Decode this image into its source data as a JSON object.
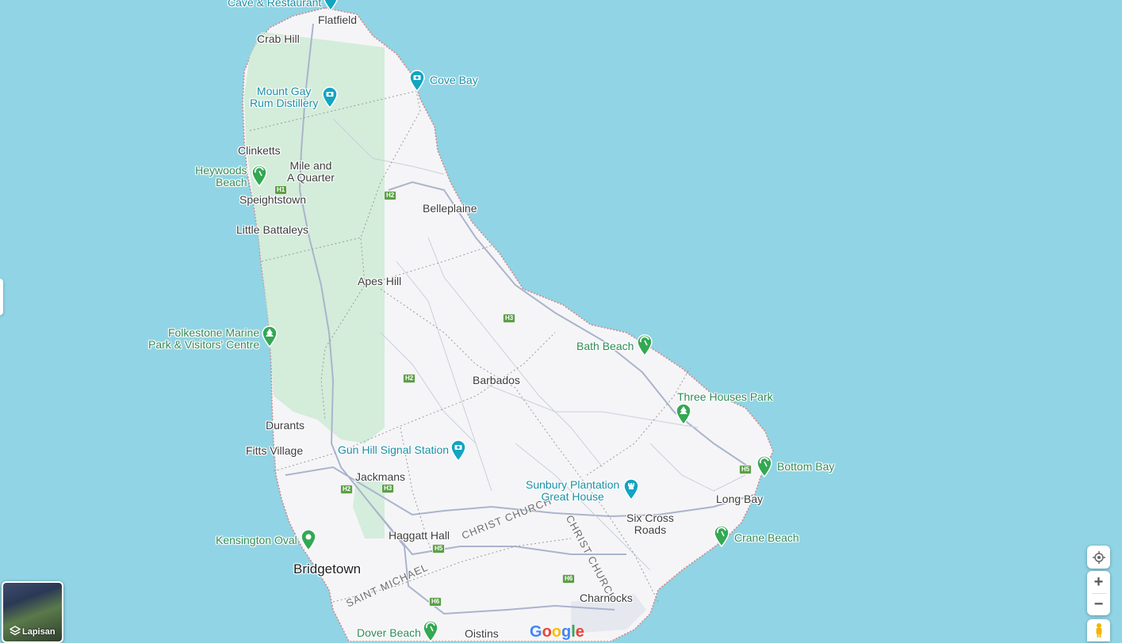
{
  "map": {
    "places": {
      "flatfield": "Flatfield",
      "crab_hill": "Crab Hill",
      "clinketts": "Clinketts",
      "mile_and_quarter_1": "Mile and",
      "mile_and_quarter_2": "A Quarter",
      "speightstown": "Speightstown",
      "little_battaleys": "Little Battaleys",
      "belleplaine": "Belleplaine",
      "apes_hill": "Apes Hill",
      "barbados": "Barbados",
      "durants": "Durants",
      "fitts_village": "Fitts Village",
      "jackmans": "Jackmans",
      "haggatt_hall": "Haggatt Hall",
      "bridgetown": "Bridgetown",
      "long_bay": "Long Bay",
      "six_cross_roads_1": "Six Cross",
      "six_cross_roads_2": "Roads",
      "charnocks": "Charnocks",
      "oistins": "Oistins"
    },
    "pois": {
      "cave_restaurant": "Cave & Restaurant",
      "cove_bay": "Cove Bay",
      "mount_gay_1": "Mount Gay",
      "mount_gay_2": "Rum Distillery",
      "heywoods_1": "Heywoods",
      "heywoods_2": "Beach",
      "folkestone_1": "Folkestone Marine",
      "folkestone_2": "Park & Visitors' Centre",
      "bath_beach": "Bath Beach",
      "three_houses_park": "Three Houses Park",
      "bottom_bay": "Bottom Bay",
      "gun_hill": "Gun Hill Signal Station",
      "sunbury_1": "Sunbury Plantation",
      "sunbury_2": "Great House",
      "crane_beach": "Crane Beach",
      "kensington_oval": "Kensington Oval",
      "dover_beach": "Dover Beach"
    },
    "parishes": {
      "christ_church_a": "CHRIST CHURCH",
      "christ_church_b": "CHRIST CHURCH",
      "saint_michael": "SAINT MICHAEL"
    },
    "road_shields": [
      "H1",
      "H2",
      "H3",
      "H2",
      "H2",
      "H3",
      "H5",
      "H5",
      "H6",
      "H6"
    ]
  },
  "controls": {
    "layers_label": "Lapisan",
    "zoom_in": "+",
    "zoom_out": "−",
    "google_logo": "Google"
  },
  "colors": {
    "water": "#90d4e5",
    "land": "#f7f6f4",
    "park": "#cdebd5",
    "poi_blue": "#1a8fa6",
    "poi_green": "#2e8b57"
  }
}
